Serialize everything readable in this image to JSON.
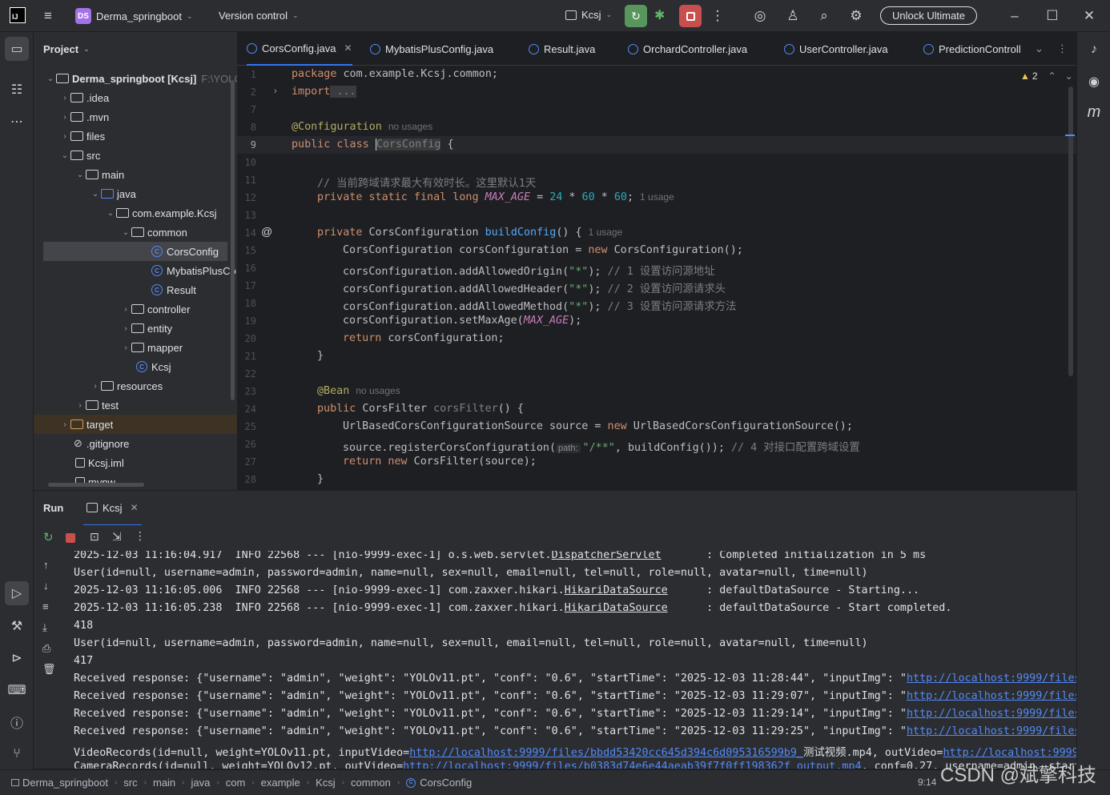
{
  "titlebar": {
    "project_initials": "DS",
    "project_name": "Derma_springboot",
    "vcs": "Version control",
    "run_config": "Kcsj",
    "unlock": "Unlock Ultimate"
  },
  "project_panel": {
    "title": "Project",
    "root": "Derma_springboot [Kcsj]",
    "root_path": "F:\\YOLO",
    "items": [
      {
        "label": ".idea"
      },
      {
        "label": ".mvn"
      },
      {
        "label": "files"
      },
      {
        "label": "src"
      },
      {
        "label": "main"
      },
      {
        "label": "java"
      },
      {
        "label": "com.example.Kcsj"
      },
      {
        "label": "common"
      },
      {
        "label": "CorsConfig"
      },
      {
        "label": "MybatisPlusCo"
      },
      {
        "label": "Result"
      },
      {
        "label": "controller"
      },
      {
        "label": "entity"
      },
      {
        "label": "mapper"
      },
      {
        "label": "Kcsj"
      },
      {
        "label": "resources"
      },
      {
        "label": "test"
      },
      {
        "label": "target"
      },
      {
        "label": ".gitignore"
      },
      {
        "label": "Kcsj.iml"
      },
      {
        "label": "mvnw"
      }
    ]
  },
  "tabs": [
    {
      "label": "CorsConfig.java"
    },
    {
      "label": "MybatisPlusConfig.java"
    },
    {
      "label": "Result.java"
    },
    {
      "label": "OrchardController.java"
    },
    {
      "label": "UserController.java"
    },
    {
      "label": "PredictionControll"
    }
  ],
  "editor": {
    "warnings": "2",
    "lines": [
      "1",
      "2",
      "7",
      "8",
      "9",
      "10",
      "11",
      "12",
      "13",
      "14",
      "15",
      "16",
      "17",
      "18",
      "19",
      "20",
      "21",
      "22",
      "23",
      "24",
      "25",
      "26",
      "27",
      "28"
    ],
    "code": {
      "l1_kw": "package",
      "l1_rest": " com.example.Kcsj.common;",
      "l2_kw": "import",
      "l2_rest": " ...",
      "l8_ann": "@Configuration",
      "l8_hint": "no usages",
      "l9_kw": "public class",
      "l9_name": "CorsConfig",
      "l9_rest": " {",
      "l11": "// 当前跨域请求最大有效时长。这里默认1天",
      "l12_kw": "private static final long",
      "l12_const": "MAX_AGE",
      "l12_eq": " = ",
      "l12_n1": "24",
      "l12_op1": " * ",
      "l12_n2": "60",
      "l12_op2": " * ",
      "l12_n3": "60",
      "l12_end": ";",
      "l12_hint": "1 usage",
      "l14_kw": "private",
      "l14_type": " CorsConfiguration ",
      "l14_fn": "buildConfig",
      "l14_rest": "() {",
      "l14_hint": "1 usage",
      "l15_a": "CorsConfiguration corsConfiguration = ",
      "l15_kw": "new",
      "l15_b": " CorsConfiguration();",
      "l16_a": "corsConfiguration.addAllowedOrigin(",
      "l16_str": "\"*\"",
      "l16_b": "); ",
      "l16_cmt": "// 1 设置访问源地址",
      "l17_a": "corsConfiguration.addAllowedHeader(",
      "l17_str": "\"*\"",
      "l17_b": "); ",
      "l17_cmt": "// 2 设置访问源请求头",
      "l18_a": "corsConfiguration.addAllowedMethod(",
      "l18_str": "\"*\"",
      "l18_b": "); ",
      "l18_cmt": "// 3 设置访问源请求方法",
      "l19_a": "corsConfiguration.setMaxAge(",
      "l19_const": "MAX_AGE",
      "l19_b": ");",
      "l20_kw": "return",
      "l20_rest": " corsConfiguration;",
      "l21": "}",
      "l23_ann": "@Bean",
      "l23_hint": "no usages",
      "l24_kw": "public",
      "l24_type": " CorsFilter ",
      "l24_fn": "corsFilter",
      "l24_rest": "() {",
      "l25_a": "UrlBasedCorsConfigurationSource source = ",
      "l25_kw": "new",
      "l25_b": " UrlBasedCorsConfigurationSource();",
      "l26_a": "source.registerCorsConfiguration(",
      "l26_param": "path:",
      "l26_str": "\"/**\"",
      "l26_b": ", buildConfig()); ",
      "l26_cmt": "// 4 对接口配置跨域设置",
      "l27_kw": "return new",
      "l27_rest": " CorsFilter(source);",
      "l28": "}"
    }
  },
  "run": {
    "title": "Run",
    "tab": "Kcsj",
    "console": {
      "c1_a": "2025-12-03 11:16:04.917  INFO 22568 --- [nio-9999-exec-1] o.s.web.servlet.",
      "c1_u": "DispatcherServlet",
      "c1_b": "       : Completed initialization in 5 ms",
      "c2": "User(id=null, username=admin, password=admin, name=null, sex=null, email=null, tel=null, role=null, avatar=null, time=null)",
      "c3_a": "2025-12-03 11:16:05.006  INFO 22568 --- [nio-9999-exec-1] com.zaxxer.hikari.",
      "c3_u": "HikariDataSource",
      "c3_b": "      : defaultDataSource - Starting...",
      "c4_a": "2025-12-03 11:16:05.238  INFO 22568 --- [nio-9999-exec-1] com.zaxxer.hikari.",
      "c4_u": "HikariDataSource",
      "c4_b": "      : defaultDataSource - Start completed.",
      "c5": "418",
      "c6": "User(id=null, username=admin, password=admin, name=null, sex=null, email=null, tel=null, role=null, avatar=null, time=null)",
      "c7": "417",
      "c8_a": "Received response: {\"username\": \"admin\", \"weight\": \"YOLOv11.pt\", \"conf\": \"0.6\", \"startTime\": \"2025-12-03 11:28:44\", \"inputImg\": \"",
      "c8_link": "http://localhost:9999/files/",
      "c9_a": "Received response: {\"username\": \"admin\", \"weight\": \"YOLOv11.pt\", \"conf\": \"0.6\", \"startTime\": \"2025-12-03 11:29:07\", \"inputImg\": \"",
      "c9_link": "http://localhost:9999/files/",
      "c10_a": "Received response: {\"username\": \"admin\", \"weight\": \"YOLOv11.pt\", \"conf\": \"0.6\", \"startTime\": \"2025-12-03 11:29:14\", \"inputImg\": \"",
      "c10_link": "http://localhost:9999/files/",
      "c11_a": "Received response: {\"username\": \"admin\", \"weight\": \"YOLOv11.pt\", \"conf\": \"0.6\", \"startTime\": \"2025-12-03 11:29:25\", \"inputImg\": \"",
      "c11_link": "http://localhost:9999/files/",
      "c12_a": "VideoRecords(id=null, weight=YOLOv11.pt, inputVideo=",
      "c12_link1": "http://localhost:9999/files/bbdd53420cc645d394c6d095316599b9_",
      "c12_b": "测试视频.mp4, outVideo=",
      "c12_link2": "http://localhost:9999/",
      "c13_a": "CameraRecords(id=null, weight=YOLOv12.pt, outVideo=",
      "c13_link": "http://localhost:9999/files/b0383d74e6e44aeab39f7f0ff198362f_output.mp4",
      "c13_b": ", conf=0.27, username=admin, startT"
    }
  },
  "statusbar": {
    "crumbs": [
      "Derma_springboot",
      "src",
      "main",
      "java",
      "com",
      "example",
      "Kcsj",
      "common",
      "CorsConfig"
    ],
    "position": "9:14"
  },
  "watermark": "CSDN @斌擎科技"
}
